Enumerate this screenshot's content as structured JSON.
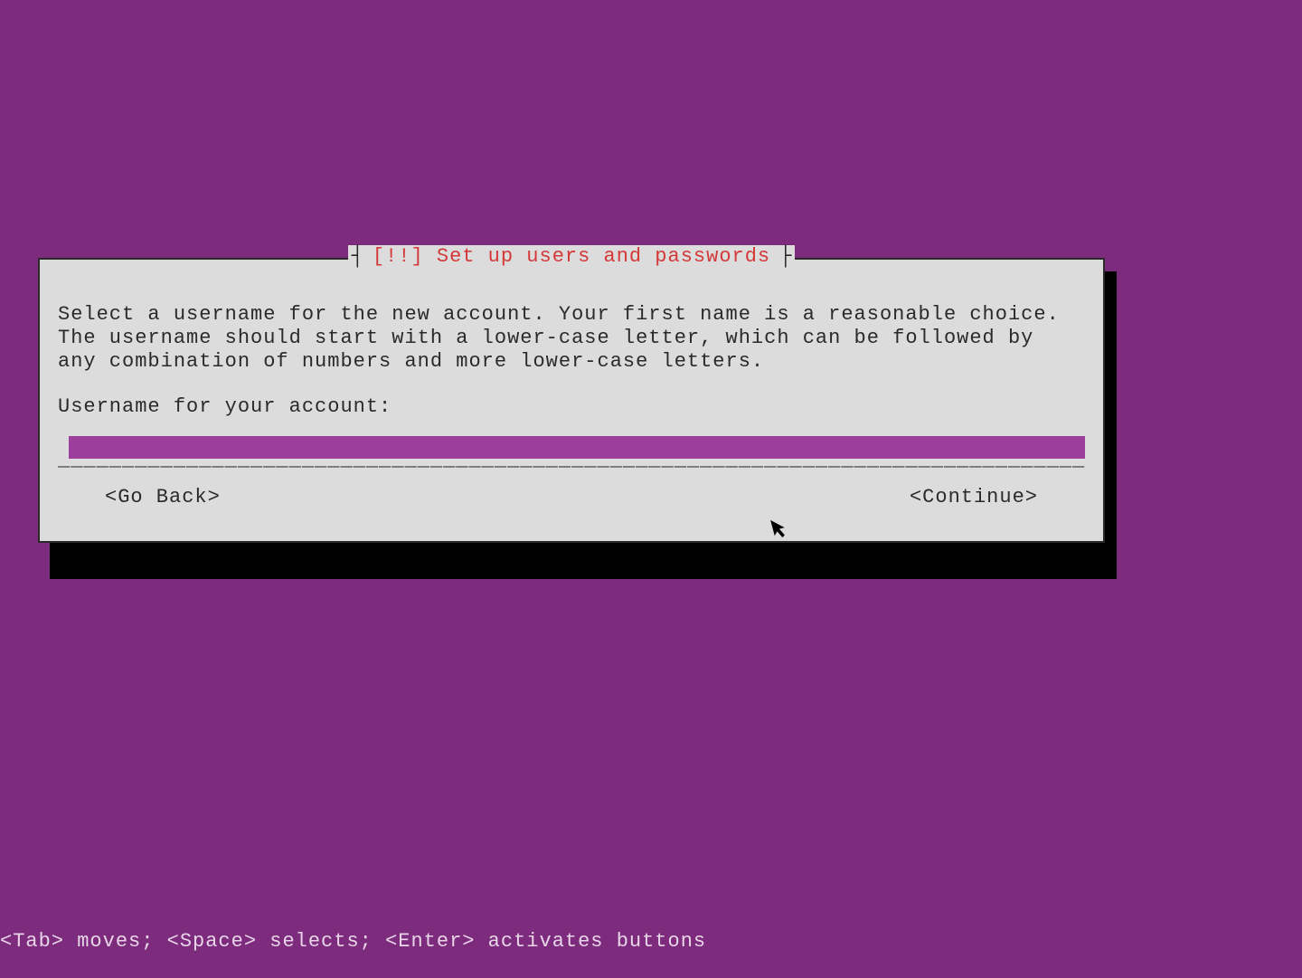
{
  "dialog": {
    "title": "[!!] Set up users and passwords",
    "body": "Select a username for the new account. Your first name is a reasonable choice. The username should start with a lower-case letter, which can be followed by any combination of numbers and more lower-case letters.",
    "prompt": "Username for your account:",
    "input_value": "",
    "go_back": "<Go Back>",
    "continue": "<Continue>"
  },
  "footer": {
    "help": "<Tab> moves; <Space> selects; <Enter> activates buttons"
  }
}
